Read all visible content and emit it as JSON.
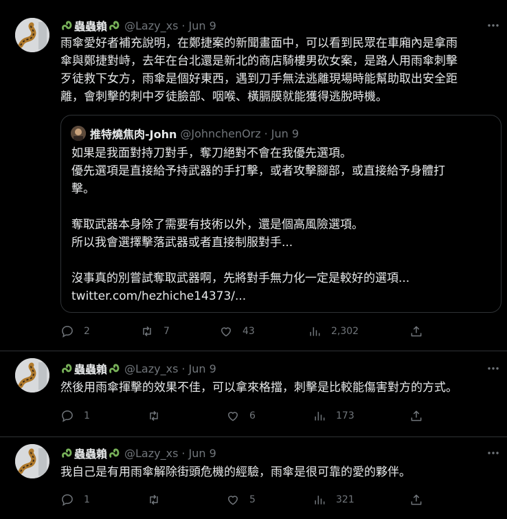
{
  "tweets": [
    {
      "display_name": "蟲蟲賴",
      "handle": "@Lazy_xs",
      "dot": "·",
      "date": "Jun 9",
      "text": "雨傘愛好者補充說明，在鄭捷案的新聞畫面中，可以看到民眾在車廂內是拿雨\n傘與鄭捷對峙，去年在台北還是新北的商店騎樓男砍女案，是路人用雨傘刺擊\n歹徒救下女方，雨傘是個好東西，遇到刀手無法逃離現場時能幫助取出安全距\n離，會刺擊的刺中歹徒臉部、咽喉、橫膈膜就能獲得逃脫時機。",
      "quote": {
        "display_name": "推特燒焦肉-John",
        "handle": "@JohnchenOrz",
        "dot": "·",
        "date": "Jun 9",
        "text": "如果是我面對持刀對手，奪刀絕對不會在我優先選項。\n優先選項是直接給予持武器的手打擊，或者攻擊腳部，或直接給予身體打\n擊。\n\n奪取武器本身除了需要有技術以外，還是個高風險選項。\n所以我會選擇擊落武器或者直接制服對手...\n\n沒事真的別嘗試奪取武器啊，先將對手無力化一定是較好的選項...\ntwitter.com/hezhiche14373/..."
      },
      "replies": "2",
      "retweets": "7",
      "likes": "43",
      "views": "2,302"
    },
    {
      "display_name": "蟲蟲賴",
      "handle": "@Lazy_xs",
      "dot": "·",
      "date": "Jun 9",
      "text": "然後用雨傘揮擊的效果不佳，可以拿來格擋，刺擊是比較能傷害對方的方式。",
      "replies": "1",
      "retweets": "",
      "likes": "6",
      "views": "173"
    },
    {
      "display_name": "蟲蟲賴",
      "handle": "@Lazy_xs",
      "dot": "·",
      "date": "Jun 9",
      "text": "我自己是有用雨傘解除街頭危機的經驗，雨傘是很可靠的愛的夥伴。",
      "replies": "1",
      "retweets": "",
      "likes": "5",
      "views": "321"
    }
  ],
  "colors": {
    "background": "#000000",
    "text": "#e7e9ea",
    "muted": "#71767b",
    "border": "#2f3336",
    "emoji_green": "#78b159"
  },
  "icons": [
    "more-icon",
    "reply-icon",
    "retweet-icon",
    "like-icon",
    "views-icon",
    "share-icon",
    "snake-emoji-icon"
  ]
}
